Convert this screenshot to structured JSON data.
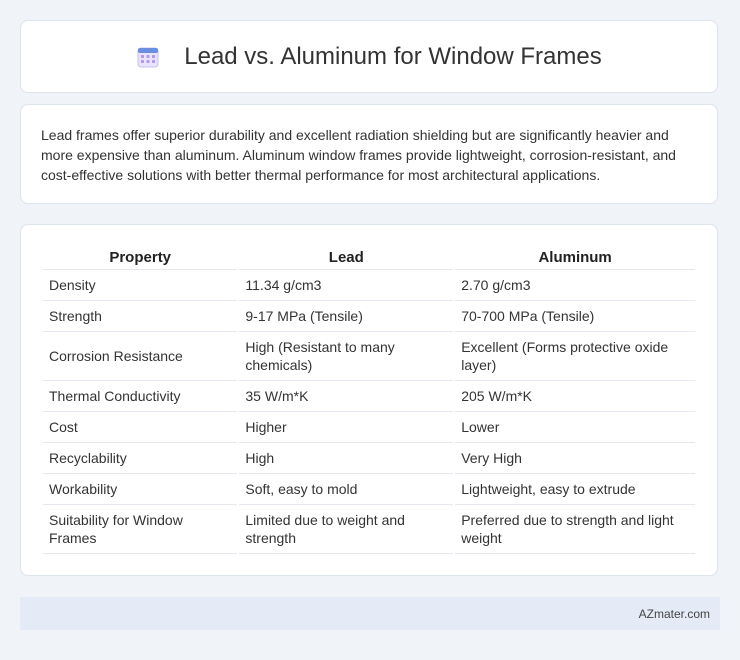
{
  "header": {
    "icon": "calendar-grid-icon",
    "title": "Lead vs. Aluminum for Window Frames"
  },
  "summary": {
    "text": "Lead frames offer superior durability and excellent radiation shielding but are significantly heavier and more expensive than aluminum. Aluminum window frames provide lightweight, corrosion-resistant, and cost-effective solutions with better thermal performance for most architectural applications."
  },
  "table": {
    "headers": [
      "Property",
      "Lead",
      "Aluminum"
    ],
    "rows": [
      [
        "Density",
        "11.34 g/cm3",
        "2.70 g/cm3"
      ],
      [
        "Strength",
        "9-17 MPa (Tensile)",
        "70-700 MPa (Tensile)"
      ],
      [
        "Corrosion Resistance",
        "High (Resistant to many chemicals)",
        "Excellent (Forms protective oxide layer)"
      ],
      [
        "Thermal Conductivity",
        "35 W/m*K",
        "205 W/m*K"
      ],
      [
        "Cost",
        "Higher",
        "Lower"
      ],
      [
        "Recyclability",
        "High",
        "Very High"
      ],
      [
        "Workability",
        "Soft, easy to mold",
        "Lightweight, easy to extrude"
      ],
      [
        "Suitability for Window Frames",
        "Limited due to weight and strength",
        "Preferred due to strength and light weight"
      ]
    ]
  },
  "footer": {
    "credit": "AZmater.com"
  }
}
